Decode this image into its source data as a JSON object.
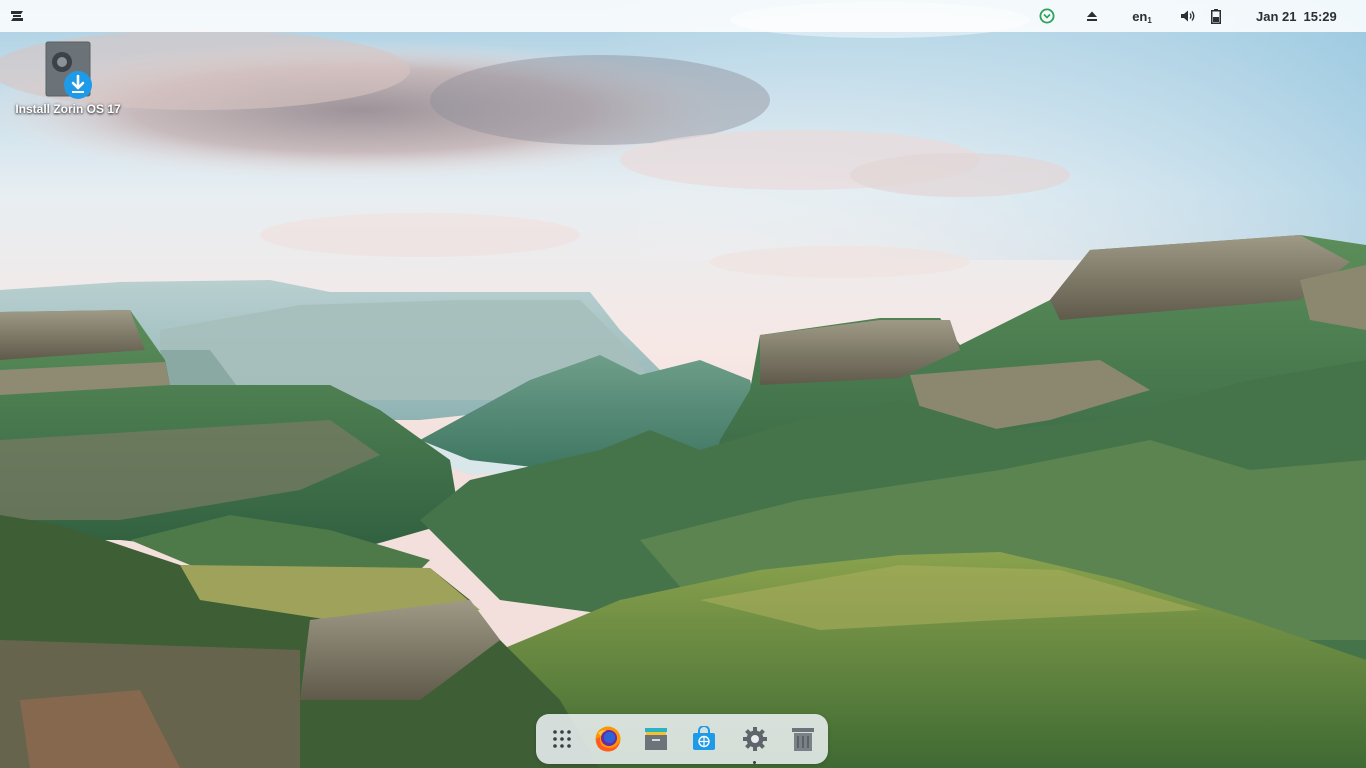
{
  "topbar": {
    "menu_icon": "zorin-logo-icon",
    "tray": {
      "updates_icon": "software-updates-icon",
      "eject_icon": "eject-icon",
      "language": "en",
      "language_sub": "1",
      "volume_icon": "volume-icon",
      "battery_icon": "battery-icon"
    },
    "clock": {
      "date": "Jan 21",
      "time": "15:29"
    }
  },
  "desktop": {
    "icons": [
      {
        "label": "Install Zorin OS 17",
        "icon": "install-disk-icon"
      }
    ]
  },
  "dock": {
    "items": [
      {
        "name": "Show Applications",
        "icon": "app-grid-icon"
      },
      {
        "name": "Firefox",
        "icon": "firefox-icon"
      },
      {
        "name": "Files",
        "icon": "files-icon"
      },
      {
        "name": "Software",
        "icon": "software-store-icon"
      },
      {
        "name": "Settings",
        "icon": "settings-gear-icon",
        "running": true
      },
      {
        "name": "Trash",
        "icon": "trash-icon"
      }
    ]
  },
  "colors": {
    "accent": "#1e9be8",
    "topbar_bg": "#f3f6f7",
    "updates_green": "#2aa457"
  }
}
